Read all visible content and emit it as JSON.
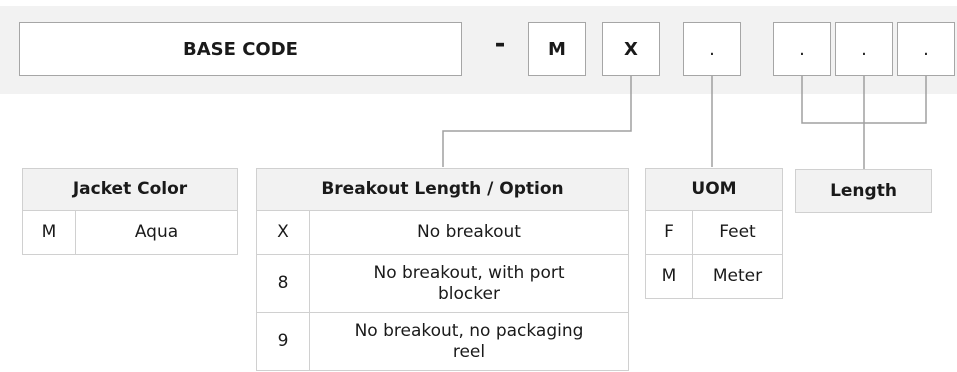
{
  "code": {
    "base_label": "BASE CODE",
    "dash": "-",
    "positions": [
      "M",
      "X",
      ".",
      ".",
      ".",
      "."
    ]
  },
  "tables": {
    "jacket_color": {
      "title": "Jacket Color",
      "rows": [
        [
          "M",
          "Aqua"
        ]
      ]
    },
    "breakout": {
      "title": "Breakout Length / Option",
      "rows": [
        [
          "X",
          "No breakout"
        ],
        [
          "8",
          "No breakout, with port blocker"
        ],
        [
          "9",
          "No breakout, no packaging reel"
        ]
      ]
    },
    "uom": {
      "title": "UOM",
      "rows": [
        [
          "F",
          "Feet"
        ],
        [
          "M",
          "Meter"
        ]
      ]
    },
    "length": {
      "title": "Length"
    }
  },
  "colors": {
    "code_bar_bg": "#f2f2f2",
    "box_border": "#a6a6a6",
    "table_header_bg": "#f2f2f2",
    "connector": "#a0a0a0"
  }
}
